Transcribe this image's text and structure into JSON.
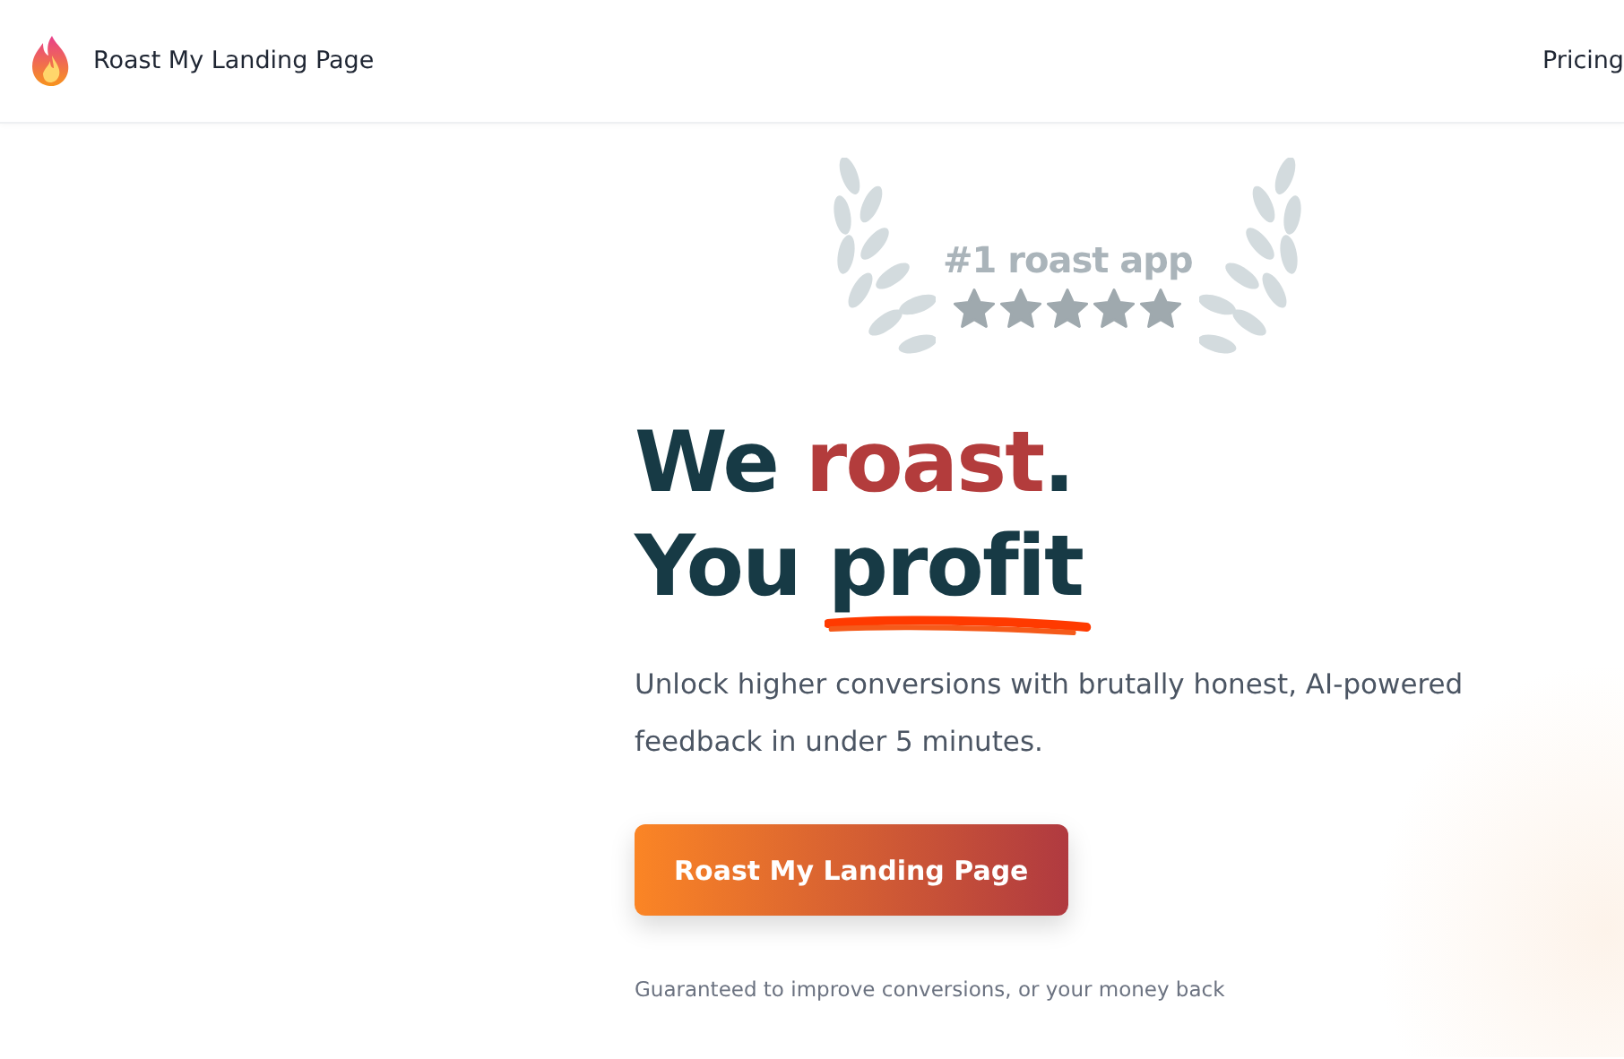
{
  "header": {
    "brand": "Roast My Landing Page",
    "nav": [
      {
        "label": "Pricing"
      }
    ]
  },
  "badge": {
    "title": "#1 roast app",
    "stars": 5
  },
  "headline": [
    [
      {
        "text": "We ",
        "kind": "plain"
      },
      {
        "text": "roast",
        "kind": "accent"
      },
      {
        "text": ".",
        "kind": "plain"
      }
    ],
    [
      {
        "text": "You ",
        "kind": "plain"
      },
      {
        "text": "profit",
        "kind": "underline"
      }
    ]
  ],
  "subtitle": "Unlock higher conversions with brutally honest, AI-powered feedback in under 5 minutes.",
  "cta": {
    "label": "Roast My Landing Page"
  },
  "guarantee": "Guaranteed to improve conversions, or your money back"
}
